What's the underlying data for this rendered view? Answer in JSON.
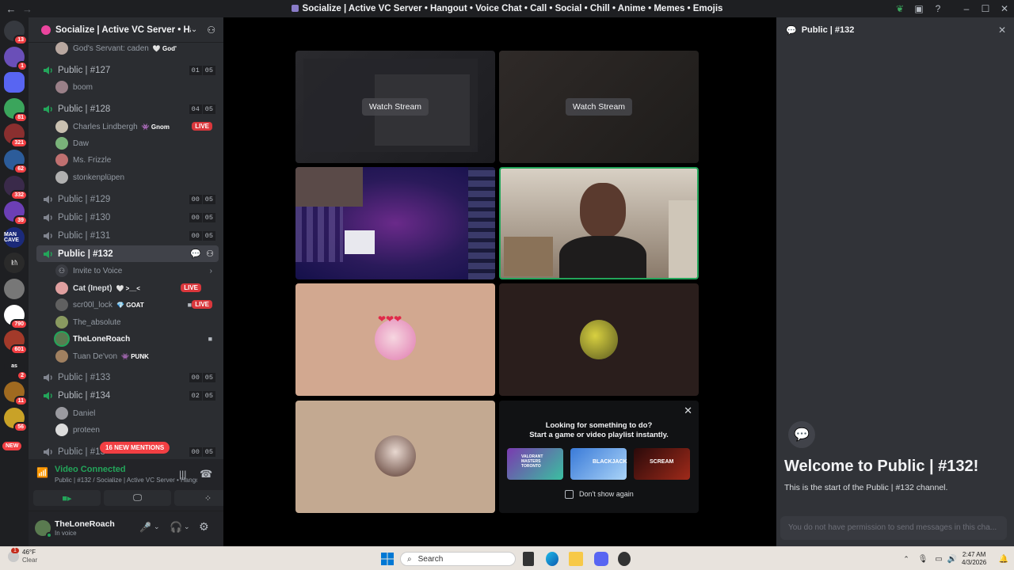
{
  "window": {
    "title": "Socialize | Active VC Server • Hangout • Voice Chat • Call • Social • Chill • Anime • Memes • Emojis"
  },
  "guilds": [
    {
      "badge": "13",
      "color": "#36393f"
    },
    {
      "badge": "1",
      "color": "#6a4fb8"
    },
    {
      "badge": "",
      "color": "#5865f2"
    },
    {
      "badge": "81",
      "color": "#3ba55c"
    },
    {
      "badge": "321",
      "color": "#8a2f2f"
    },
    {
      "badge": "62",
      "color": "#2c5c9a"
    },
    {
      "badge": "332",
      "color": "#3a2a4a"
    },
    {
      "badge": "39",
      "color": "#6c3fb5"
    },
    {
      "badge": "",
      "color": "#1b2a7a",
      "text": "MAN CAVE"
    },
    {
      "badge": "",
      "color": "#2a2a2a",
      "text": "ᚱᚢ"
    },
    {
      "badge": "",
      "color": "#777777"
    },
    {
      "badge": "790",
      "color": "#ffffff"
    },
    {
      "badge": "601",
      "color": "#a33a2a"
    },
    {
      "badge": "2",
      "color": "#1e1f22",
      "text": "as"
    },
    {
      "badge": "11",
      "color": "#a06a20"
    },
    {
      "badge": "56",
      "color": "#c9a227"
    }
  ],
  "guild_new": "NEW",
  "server": {
    "name": "Socialize | Active VC Server • Han..."
  },
  "channels": {
    "top_user": {
      "name": "God's Servant: caden",
      "tag": "God'"
    },
    "c127": {
      "name": "Public | #127",
      "n1": "01",
      "n2": "05",
      "users": [
        {
          "name": "boom"
        }
      ]
    },
    "c128": {
      "name": "Public | #128",
      "n1": "04",
      "n2": "05",
      "live": "LIVE",
      "users": [
        {
          "name": "Charles Lindbergh",
          "tag": "Gnom"
        },
        {
          "name": "Daw"
        },
        {
          "name": "Ms. Frizzle"
        },
        {
          "name": "stonkenplüpen"
        }
      ]
    },
    "c129": {
      "name": "Public | #129",
      "n1": "00",
      "n2": "05"
    },
    "c130": {
      "name": "Public | #130",
      "n1": "00",
      "n2": "05"
    },
    "c131": {
      "name": "Public | #131",
      "n1": "00",
      "n2": "05"
    },
    "c132": {
      "name": "Public | #132",
      "invite": "Invite to Voice",
      "users": [
        {
          "name": "Cat (Inept)",
          "tag": ">__<",
          "live": "LIVE"
        },
        {
          "name": "scr00l_lock",
          "tag": "GOAT",
          "live": "LIVE"
        },
        {
          "name": "The_absolute"
        },
        {
          "name": "TheLoneRoach"
        },
        {
          "name": "Tuan De'von",
          "tag": "PUNK"
        }
      ]
    },
    "c133": {
      "name": "Public | #133",
      "n1": "00",
      "n2": "05"
    },
    "c134": {
      "name": "Public | #134",
      "n1": "02",
      "n2": "05",
      "users": [
        {
          "name": "Daniel"
        },
        {
          "name": "proteen"
        }
      ]
    },
    "c135": {
      "name": "Public | #13",
      "n1": "00",
      "n2": "05"
    }
  },
  "mentions": "16 NEW MENTIONS",
  "voice": {
    "status": "Video Connected",
    "sub": "Public | #132 / Socialize | Active VC Server • Hango..."
  },
  "user": {
    "name": "TheLoneRoach",
    "status": "In voice"
  },
  "stage": {
    "watch_label": "Watch Stream",
    "activity_title": "Looking for something to do?",
    "activity_sub": "Start a game or video playlist instantly.",
    "dont_show": "Don't show again",
    "games": [
      "VALORANT MASTERS TORONTO",
      "BLACKJACK",
      "SCREAM"
    ]
  },
  "side": {
    "title": "Public | #132",
    "welcome": "Welcome to Public | #132!",
    "start": "This is the start of the Public | #132 channel.",
    "placeholder": "You do not have permission to send messages in this cha..."
  },
  "taskbar": {
    "temp": "46°F",
    "cond": "Clear",
    "weather_badge": "1",
    "search": "Search",
    "time": "2:47 AM",
    "date": "4/3/2026"
  }
}
